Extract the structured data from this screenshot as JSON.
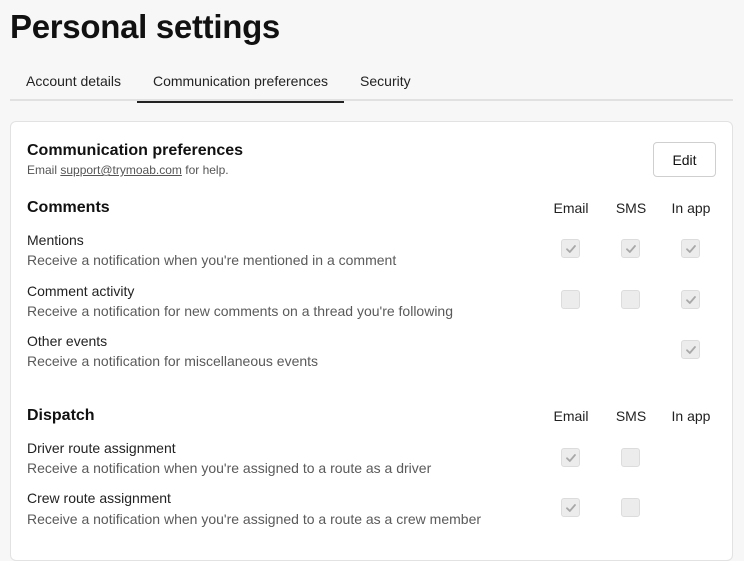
{
  "page": {
    "title": "Personal settings"
  },
  "tabs": [
    {
      "label": "Account details",
      "active": false
    },
    {
      "label": "Communication preferences",
      "active": true
    },
    {
      "label": "Security",
      "active": false
    }
  ],
  "card": {
    "title": "Communication preferences",
    "help_prefix": "Email ",
    "help_email": "support@trymoab.com",
    "help_suffix": " for help.",
    "edit_label": "Edit"
  },
  "sections": [
    {
      "title": "Comments",
      "columns": [
        "Email",
        "SMS",
        "In app"
      ],
      "rows": [
        {
          "title": "Mentions",
          "desc": "Receive a notification when you're mentioned in a comment",
          "email": true,
          "sms": true,
          "in_app": true
        },
        {
          "title": "Comment activity",
          "desc": "Receive a notification for new comments on a thread you're following",
          "email": false,
          "sms": false,
          "in_app": true
        },
        {
          "title": "Other events",
          "desc": "Receive a notification for miscellaneous events",
          "email": null,
          "sms": null,
          "in_app": true
        }
      ]
    },
    {
      "title": "Dispatch",
      "columns": [
        "Email",
        "SMS",
        "In app"
      ],
      "rows": [
        {
          "title": "Driver route assignment",
          "desc": "Receive a notification when you're assigned to a route as a driver",
          "email": true,
          "sms": false,
          "in_app": null
        },
        {
          "title": "Crew route assignment",
          "desc": "Receive a notification when you're assigned to a route as a crew member",
          "email": true,
          "sms": false,
          "in_app": null
        }
      ]
    }
  ],
  "colors": {
    "checkbox_bg": "#ececec",
    "check": "#a8a8a8"
  }
}
